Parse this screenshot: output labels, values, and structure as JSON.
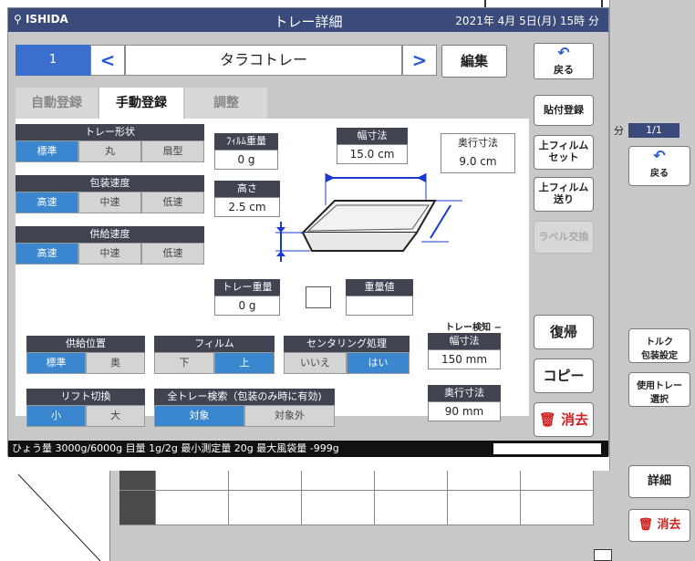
{
  "window": {
    "brand": "ISHIDA",
    "title": "トレー詳細",
    "datetime": "2021年 4月 5日(月) 15時 分"
  },
  "nav": {
    "tray_number": "1",
    "prev": "<",
    "next": ">",
    "tray_name": "タラコトレー",
    "edit_label": "編集",
    "back_icon": "↶",
    "back_label": "戻る"
  },
  "tabs": [
    {
      "label": "自動登録",
      "active": false
    },
    {
      "label": "手動登録",
      "active": true
    },
    {
      "label": "調整",
      "active": false
    }
  ],
  "tray_shape": {
    "title": "トレー形状",
    "options": [
      "標準",
      "丸",
      "扇型"
    ],
    "selected": "標準"
  },
  "pack_speed": {
    "title": "包装速度",
    "options": [
      "高速",
      "中速",
      "低速"
    ],
    "selected": "高速"
  },
  "feed_speed": {
    "title": "供給速度",
    "options": [
      "高速",
      "中速",
      "低速"
    ],
    "selected": "高速"
  },
  "film_weight": {
    "label": "ﾌｨﾙﾑ重量",
    "value": "0 g"
  },
  "width_dim": {
    "label": "幅寸法",
    "value": "15.0 cm"
  },
  "depth_dim": {
    "label": "奥行寸法",
    "value": "9.0 cm"
  },
  "height_dim": {
    "label": "高さ",
    "value": "2.5 cm"
  },
  "tray_weight": {
    "label": "トレー重量",
    "value": "0 g"
  },
  "weight_value": {
    "label": "重量値",
    "value": ""
  },
  "tray_detect": {
    "title": "トレー検知 −",
    "width_label": "幅寸法",
    "width_value": "150 mm",
    "depth_label": "奥行寸法",
    "depth_value": "90 mm"
  },
  "feed_position": {
    "title": "供給位置",
    "options": [
      "標準",
      "奥"
    ],
    "selected": "標準"
  },
  "film": {
    "title": "フィルム",
    "options": [
      "下",
      "上"
    ],
    "selected": "上"
  },
  "centering": {
    "title": "センタリング処理",
    "options": [
      "いいえ",
      "はい"
    ],
    "selected": "はい"
  },
  "lift": {
    "title": "リフト切換",
    "options": [
      "小",
      "大"
    ],
    "selected": "小"
  },
  "all_tray_search": {
    "title": "全トレー検索（包装のみ時に有効)",
    "options": [
      "対象",
      "対象外"
    ],
    "selected": "対象"
  },
  "right_buttons": {
    "paste": "貼付登録",
    "upper_film_set_1": "上フィルム",
    "upper_film_set_2": "セット",
    "upper_film_feed_1": "上フィルム",
    "upper_film_feed_2": "送り",
    "label_change": "ラベル交換",
    "restore": "復帰",
    "copy": "コピー",
    "delete_icon": "🗑",
    "delete": "消去"
  },
  "status": "ひょう量 3000g/6000g 目量 1g/2g 最小測定量 20g 最大風袋量 -999g",
  "side_panel": {
    "page_label": "分",
    "page": "1/1",
    "back_icon": "↶",
    "back": "戻る",
    "torque_1": "トルク",
    "torque_2": "包装設定",
    "use_tray_1": "使用トレー",
    "use_tray_2": "選択",
    "detail": "詳細",
    "delete_icon": "🗑",
    "delete": "消去"
  }
}
